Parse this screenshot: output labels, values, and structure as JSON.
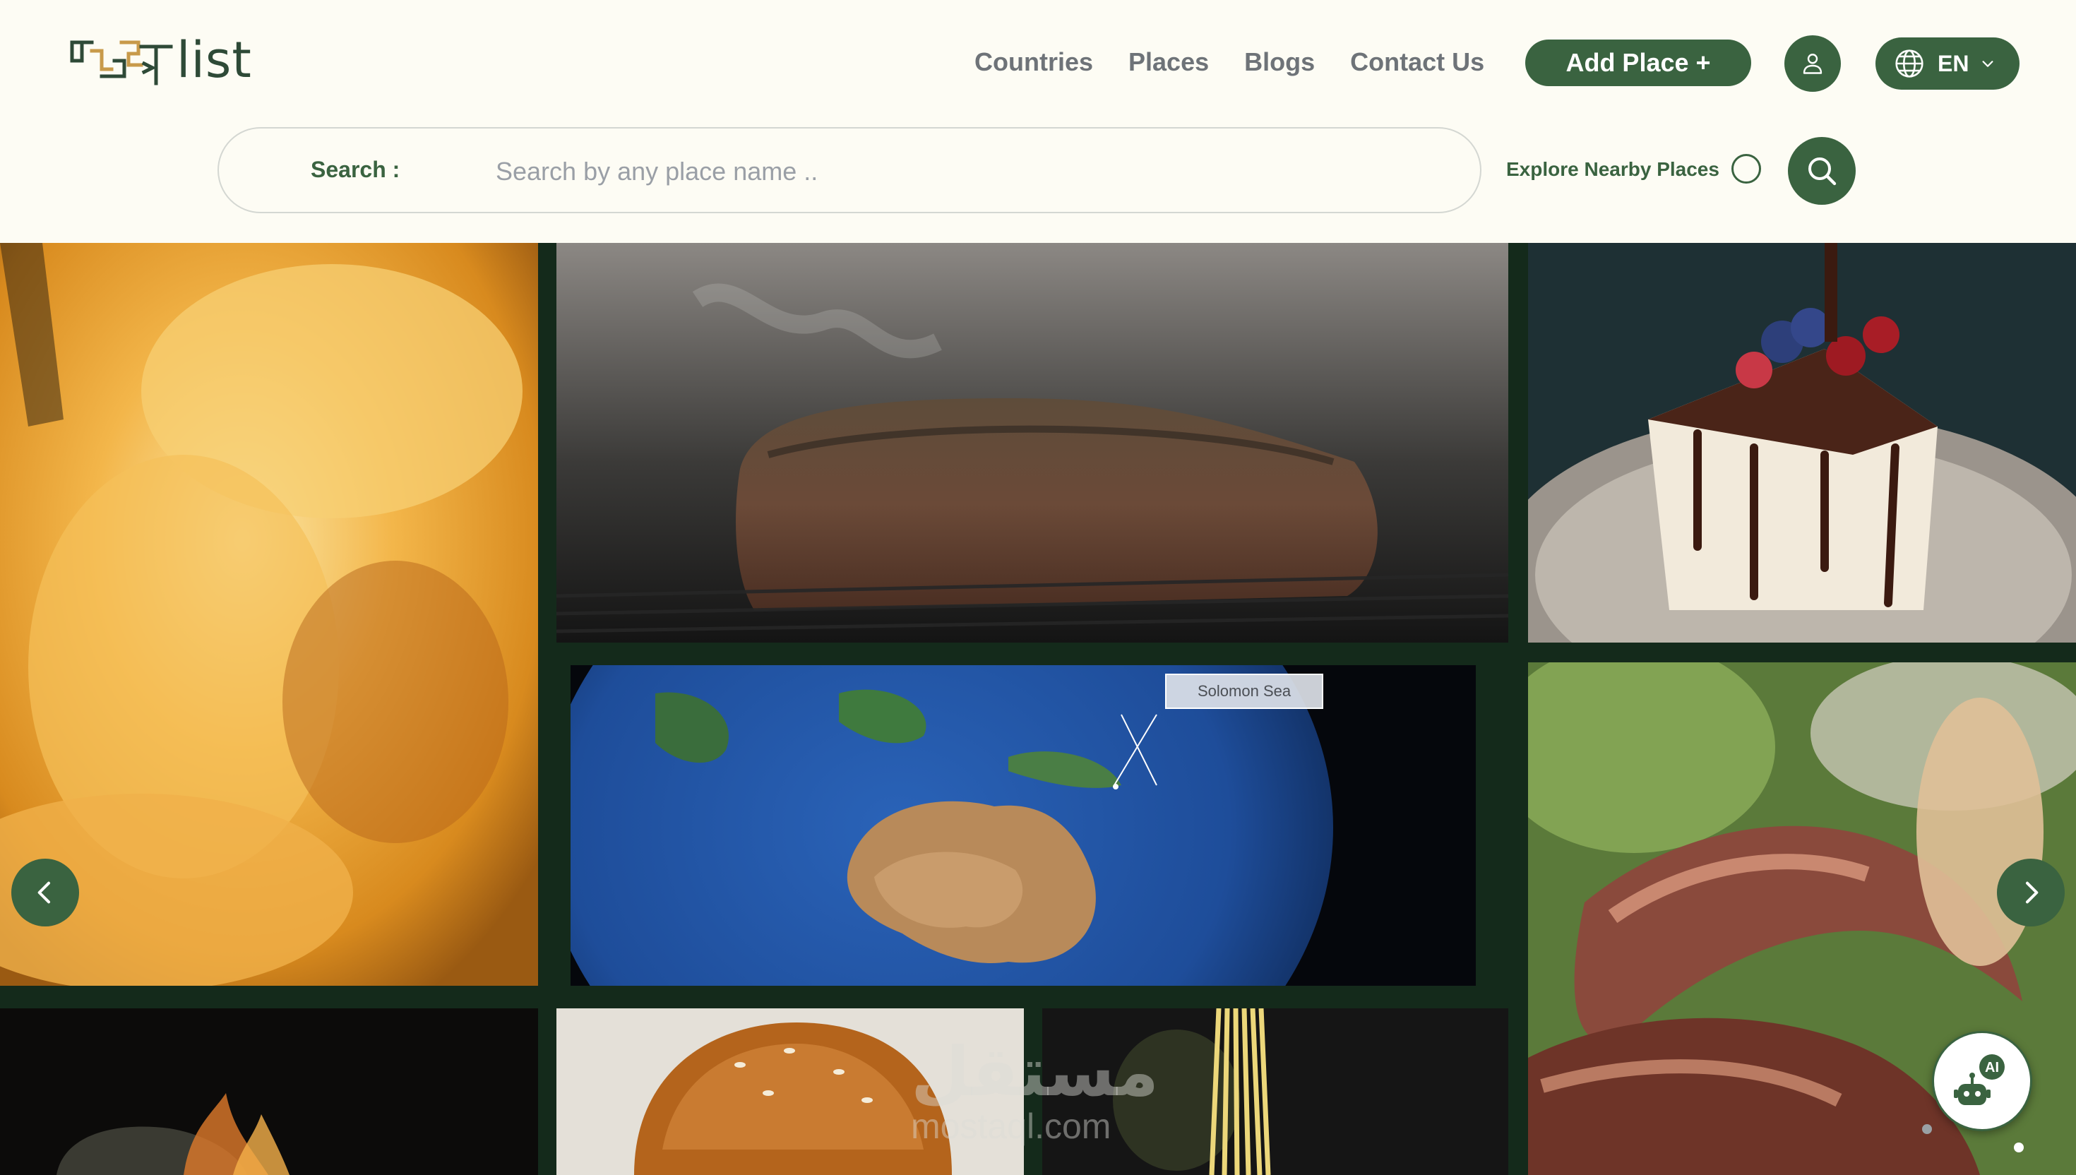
{
  "header": {
    "logo_text": "list",
    "nav": [
      {
        "label": "Countries"
      },
      {
        "label": "Places"
      },
      {
        "label": "Blogs"
      },
      {
        "label": "Contact Us"
      }
    ],
    "add_place_label": "Add Place +",
    "user_icon": "user-icon",
    "language": {
      "label": "EN",
      "icon": "globe-icon",
      "chevron": "chevron-down-icon"
    }
  },
  "search": {
    "label": "Search :",
    "placeholder": "Search by any place name ..",
    "nearby_label": "Explore Nearby Places",
    "nearby_checked": false,
    "button_icon": "search-icon"
  },
  "gallery": {
    "map_caption": "Solomon Sea",
    "prev_icon": "chevron-left-icon",
    "next_icon": "chevron-right-icon"
  },
  "watermark": {
    "arabic": "مستقل",
    "latin": "mostaql.com"
  },
  "assistant": {
    "badge": "AI",
    "icon": "robot-icon"
  },
  "colors": {
    "brand_green": "#3a6340",
    "background": "#fdfcf4",
    "nav_text": "#6e7378",
    "gallery_bg": "#142a1b"
  }
}
